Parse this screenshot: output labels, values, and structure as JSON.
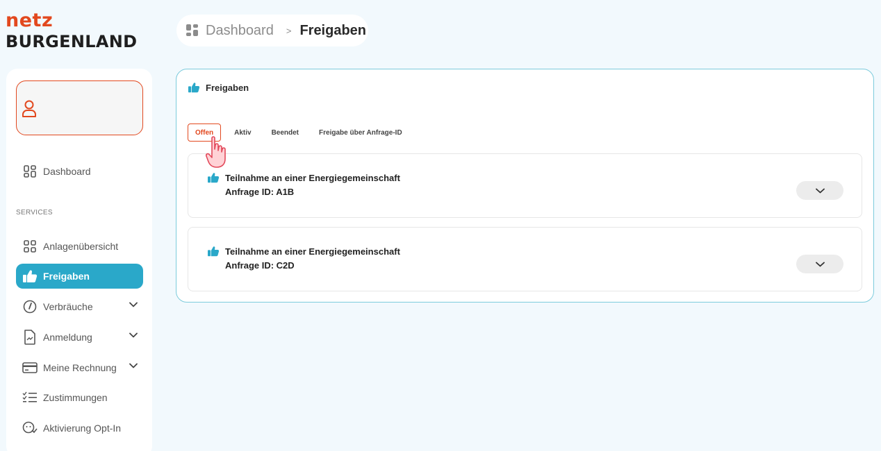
{
  "logo": {
    "line1": "netz",
    "line2": "BURGENLAND"
  },
  "breadcrumb": {
    "home": "Dashboard",
    "separator": ">",
    "current": "Freigaben"
  },
  "sidebar": {
    "user_icon": "user-icon",
    "dashboard": "Dashboard",
    "section_label": "SERVICES",
    "items": [
      {
        "label": "Anlagenübersicht",
        "icon": "grid-icon",
        "active": false,
        "expandable": false
      },
      {
        "label": "Freigaben",
        "icon": "thumbs-up-icon",
        "active": true,
        "expandable": false
      },
      {
        "label": "Verbräuche",
        "icon": "gauge-icon",
        "active": false,
        "expandable": true
      },
      {
        "label": "Anmeldung",
        "icon": "document-icon",
        "active": false,
        "expandable": true
      },
      {
        "label": "Meine Rechnung",
        "icon": "credit-card-icon",
        "active": false,
        "expandable": true
      },
      {
        "label": "Zustimmungen",
        "icon": "checklist-icon",
        "active": false,
        "expandable": false
      },
      {
        "label": "Aktivierung Opt-In",
        "icon": "opt-in-icon",
        "active": false,
        "expandable": false
      }
    ]
  },
  "main": {
    "title": "Freigaben",
    "tabs": [
      {
        "label": "Offen",
        "active": true
      },
      {
        "label": "Aktiv",
        "active": false
      },
      {
        "label": "Beendet",
        "active": false
      },
      {
        "label": "Freigabe über Anfrage-ID",
        "active": false
      }
    ],
    "requests": [
      {
        "title": "Teilnahme an einer Energiegemeinschaft",
        "id": "Anfrage ID:  A1B"
      },
      {
        "title": "Teilnahme an einer Energiegemeinschaft",
        "id": "Anfrage ID:  C2D"
      }
    ]
  },
  "colors": {
    "brand_orange": "#e2481e",
    "accent_teal": "#2aa8c9",
    "card_border": "#7ccbdc",
    "background": "#f2f9fd"
  }
}
